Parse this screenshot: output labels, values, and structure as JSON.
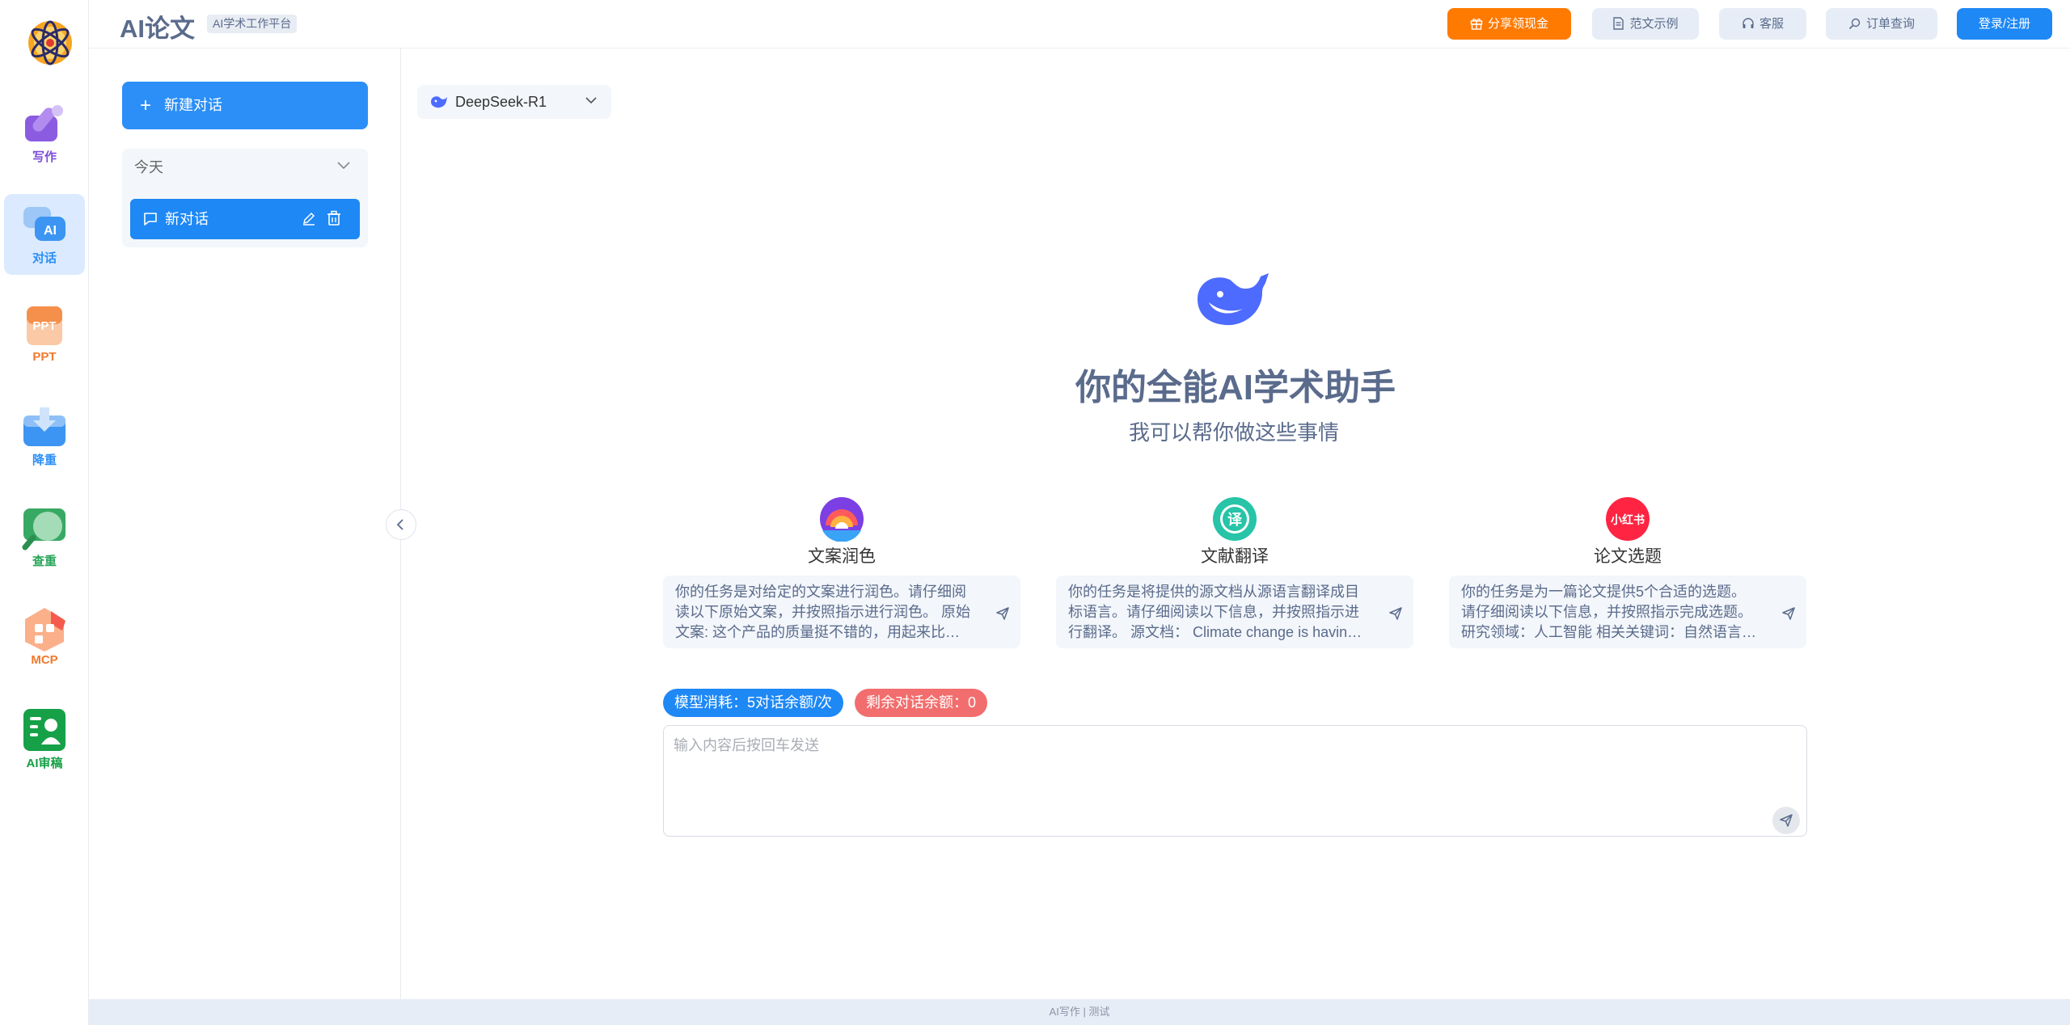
{
  "rail": {
    "items": [
      {
        "label": "写作",
        "icon": "pen-icon",
        "color": "#7c4ddc"
      },
      {
        "label": "对话",
        "icon": "chat-ai-icon",
        "color": "#2b8ff7"
      },
      {
        "label": "PPT",
        "icon": "ppt-icon",
        "color": "#f07a2c"
      },
      {
        "label": "降重",
        "icon": "download-tray-icon",
        "color": "#2b8ff7"
      },
      {
        "label": "查重",
        "icon": "magnifier-icon",
        "color": "#2aa55a"
      },
      {
        "label": "MCP",
        "icon": "mcp-icon",
        "color": "#f07a2c"
      },
      {
        "label": "AI审稿",
        "icon": "reviewer-icon",
        "color": "#15a046"
      }
    ]
  },
  "header": {
    "brand": "AI论文",
    "tag": "AI学术工作平台",
    "share": "分享领现金",
    "sample": "范文示例",
    "service": "客服",
    "order": "订单查询",
    "login": "登录/注册"
  },
  "sidebar": {
    "new_chat": "新建对话",
    "group": "今天",
    "chat_item": "新对话"
  },
  "model": {
    "selected": "DeepSeek-R1"
  },
  "hero": {
    "title": "你的全能AI学术助手",
    "subtitle": "我可以帮你做这些事情"
  },
  "cards": [
    {
      "title": "文案润色",
      "icon": "rainbow-icon",
      "text": "你的任务是对给定的文案进行润色。请仔细阅读以下原始文案，并按照指示进行润色。 原始文案: 这个产品的质量挺不错的，用起来比较方便，就是..."
    },
    {
      "title": "文献翻译",
      "icon": "translate-icon",
      "text": "你的任务是将提供的源文档从源语言翻译成目标语言。请仔细阅读以下信息，并按照指示进行翻译。 源文档： Climate change is having a profoun..."
    },
    {
      "title": "论文选题",
      "icon": "xiaohongshu-icon",
      "icon_text": "小红书",
      "text": "你的任务是为一篇论文提供5个合适的选题。请仔细阅读以下信息，并按照指示完成选题。 研究领域：人工智能 相关关键词：自然语言处理、图像..."
    }
  ],
  "badges": {
    "cost": "模型消耗：5对话余额/次",
    "remain": "剩余对话余额：0"
  },
  "input": {
    "placeholder": "输入内容后按回车发送"
  },
  "footer": {
    "text": "AI写作 | 测试"
  },
  "colors": {
    "primary": "#1e88f5",
    "share": "#ff7a00",
    "remain": "#f26d6d",
    "title": "#5a6b8c"
  }
}
